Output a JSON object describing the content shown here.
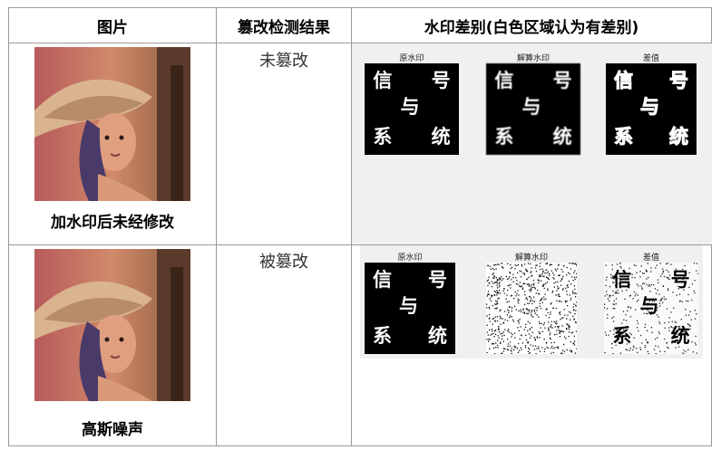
{
  "table": {
    "headers": [
      "图片",
      "篡改检测结果",
      "水印差别(白色区域认为有差别)"
    ],
    "rows": [
      {
        "caption": "加水印后未经修改",
        "status": "未篡改",
        "panels": [
          {
            "title": "原水印",
            "glyphs": [
              "信",
              "号",
              "与",
              "系",
              "统"
            ],
            "style": "clean"
          },
          {
            "title": "解算水印",
            "glyphs": [
              "信",
              "号",
              "与",
              "系",
              "统"
            ],
            "style": "blocky"
          },
          {
            "title": "差值",
            "glyphs": [
              "信",
              "号",
              "与",
              "系",
              "统"
            ],
            "style": "outline"
          }
        ]
      },
      {
        "caption": "高斯噪声",
        "status": "被篡改",
        "panels": [
          {
            "title": "原水印",
            "glyphs": [
              "信",
              "号",
              "与",
              "系",
              "统"
            ],
            "style": "clean"
          },
          {
            "title": "解算水印",
            "glyphs": [],
            "style": "noise"
          },
          {
            "title": "差值",
            "glyphs": [
              "信",
              "号",
              "与",
              "系",
              "统"
            ],
            "style": "inverted"
          }
        ]
      }
    ]
  },
  "colors": {
    "border": "#9a9a9a",
    "panel_bg": "#f0f0f0",
    "watermark_bg": "#000000",
    "watermark_fg": "#ffffff"
  },
  "icons": {
    "photo": "lena-portrait"
  }
}
